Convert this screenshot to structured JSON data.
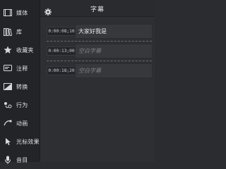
{
  "sidebar": {
    "items": [
      {
        "label": "媒体",
        "icon": "media-icon"
      },
      {
        "label": "库",
        "icon": "library-icon"
      },
      {
        "label": "收藏夹",
        "icon": "star-icon"
      },
      {
        "label": "注释",
        "icon": "annotation-icon"
      },
      {
        "label": "转换",
        "icon": "transition-icon"
      },
      {
        "label": "行为",
        "icon": "behavior-icon"
      },
      {
        "label": "动画",
        "icon": "animation-icon"
      },
      {
        "label": "光标效果",
        "icon": "cursor-effect-icon"
      },
      {
        "label": "音目",
        "icon": "microphone-icon"
      }
    ]
  },
  "panel": {
    "title": "字幕",
    "settings_icon": "gear-icon"
  },
  "captions": [
    {
      "time": "0:00:08;10",
      "text": "大家好我是",
      "empty": false
    },
    {
      "time": "0:00:13;00",
      "text": "空白字幕",
      "empty": true
    },
    {
      "time": "0:00:18;20",
      "text": "空白字幕",
      "empty": true
    }
  ],
  "colors": {
    "sidebar_bg": "#232428",
    "panel_bg": "#2e2f33",
    "caption_bg": "#37383c",
    "text": "#e6e7e9",
    "placeholder_text": "#7f8186"
  }
}
